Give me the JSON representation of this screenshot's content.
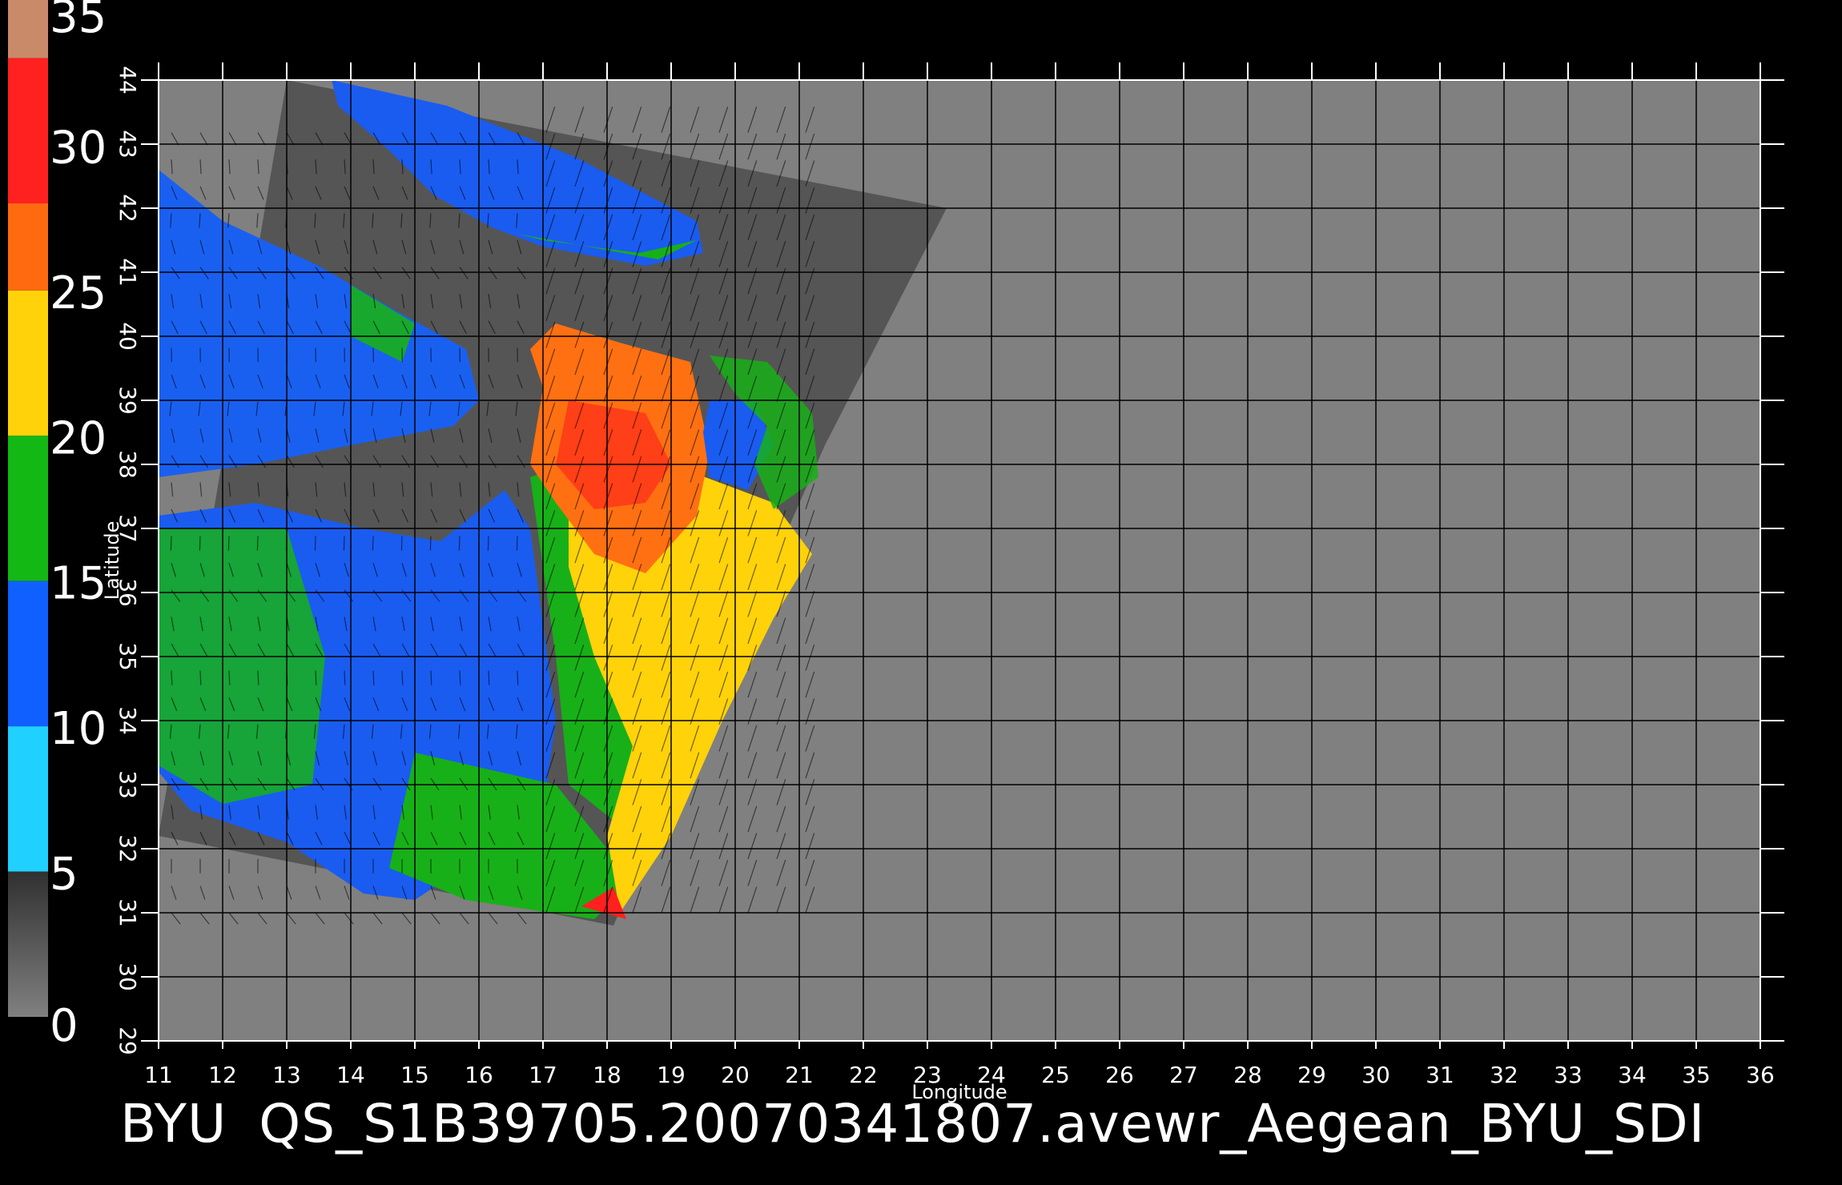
{
  "map": {
    "xlabel": "Longitude",
    "ylabel": "Latitude",
    "lon_range": [
      11,
      36
    ],
    "lat_range": [
      29,
      44
    ],
    "lon_ticks": [
      "11",
      "12",
      "13",
      "14",
      "15",
      "16",
      "17",
      "18",
      "19",
      "20",
      "21",
      "22",
      "23",
      "24",
      "25",
      "26",
      "27",
      "28",
      "29",
      "30",
      "31",
      "32",
      "33",
      "34",
      "35",
      "36"
    ],
    "lat_ticks": [
      "29",
      "30",
      "31",
      "32",
      "33",
      "34",
      "35",
      "36",
      "37",
      "38",
      "39",
      "40",
      "41",
      "42",
      "43",
      "44"
    ],
    "grid": true,
    "background_color": "#808080",
    "swath_shadow_color": "#555555",
    "swath_corners_lonlat": [
      [
        13.0,
        44.0
      ],
      [
        23.3,
        42.0
      ],
      [
        21.4,
        38.3
      ],
      [
        18.1,
        30.8
      ],
      [
        11.0,
        32.2
      ]
    ]
  },
  "colorbar": {
    "ticks": [
      "35",
      "30",
      "25",
      "20",
      "15",
      "10",
      "5",
      "0"
    ],
    "range": [
      0,
      35
    ],
    "segments": [
      {
        "from": 33,
        "to": 35,
        "color": "#c98a6a"
      },
      {
        "from": 28,
        "to": 33,
        "color": "#ff2020"
      },
      {
        "from": 25,
        "to": 28,
        "color": "#ff6a10"
      },
      {
        "from": 20,
        "to": 25,
        "color": "#ffd20a"
      },
      {
        "from": 15,
        "to": 20,
        "color": "#14b814"
      },
      {
        "from": 10,
        "to": 15,
        "color": "#1060ff"
      },
      {
        "from": 5,
        "to": 10,
        "color": "#20d0ff"
      },
      {
        "from": 0,
        "to": 5,
        "color": "#505050"
      }
    ]
  },
  "caption": {
    "left": "BYU",
    "right": "QS_S1B39705.20070341807.avewr_Aegean_BYU_SDI"
  }
}
